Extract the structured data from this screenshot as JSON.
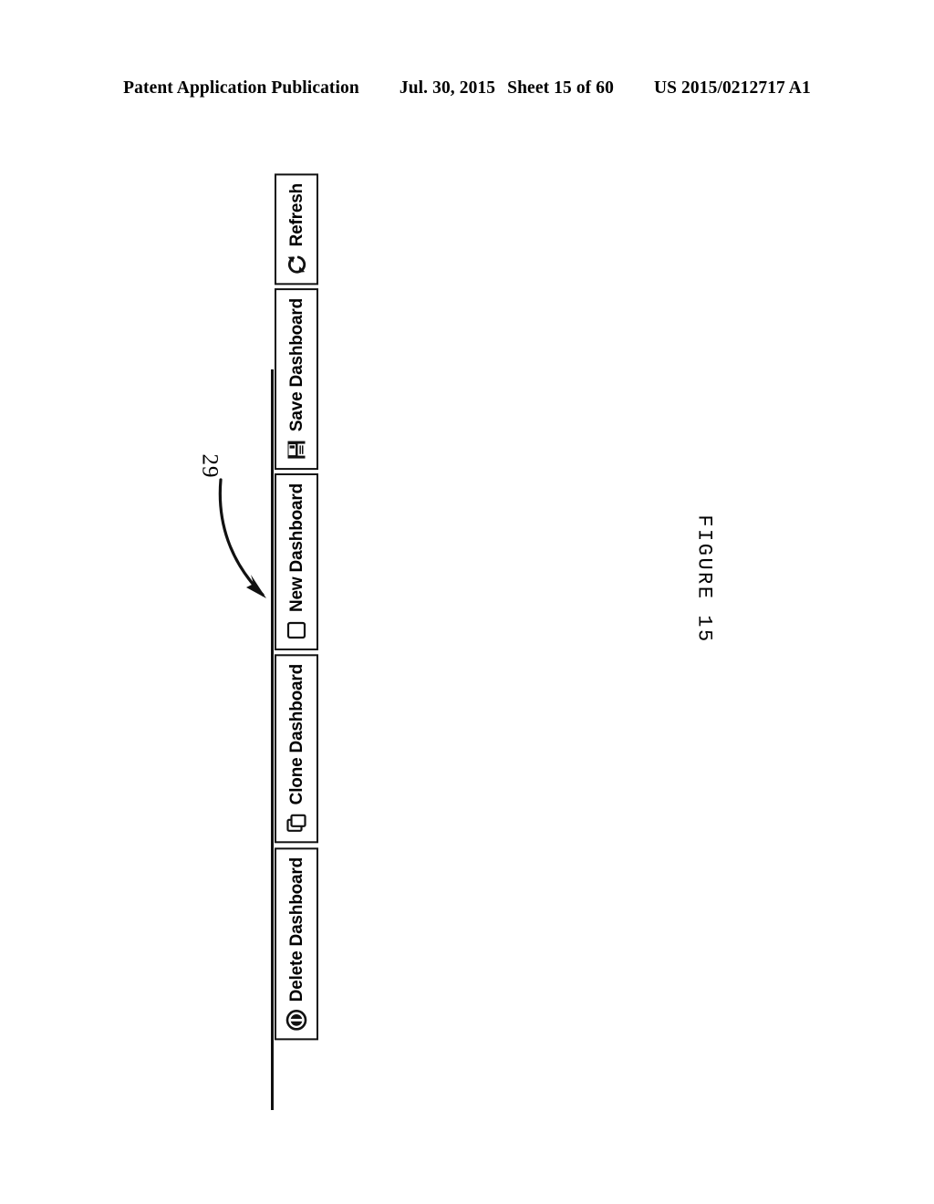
{
  "header": {
    "publication": "Patent Application Publication",
    "date": "Jul. 30, 2015",
    "sheet": "Sheet 15 of 60",
    "patent_number": "US 2015/0212717 A1"
  },
  "figure": {
    "caption": "FIGURE 15",
    "reference_numeral": "29",
    "rotation_note": "toolbar drawn rotated 90 degrees on the page"
  },
  "toolbar": {
    "name": "dashboard-toolbar",
    "buttons": [
      {
        "label": "Delete Dashboard",
        "icon": "delete-circle-icon"
      },
      {
        "label": "Clone Dashboard",
        "icon": "copy-pages-icon"
      },
      {
        "label": "New Dashboard",
        "icon": "blank-page-icon"
      },
      {
        "label": "Save Dashboard",
        "icon": "floppy-disk-icon"
      },
      {
        "label": "Refresh",
        "icon": "refresh-arrows-icon"
      }
    ]
  },
  "colors": {
    "ink": "#111111",
    "paper": "#ffffff"
  }
}
